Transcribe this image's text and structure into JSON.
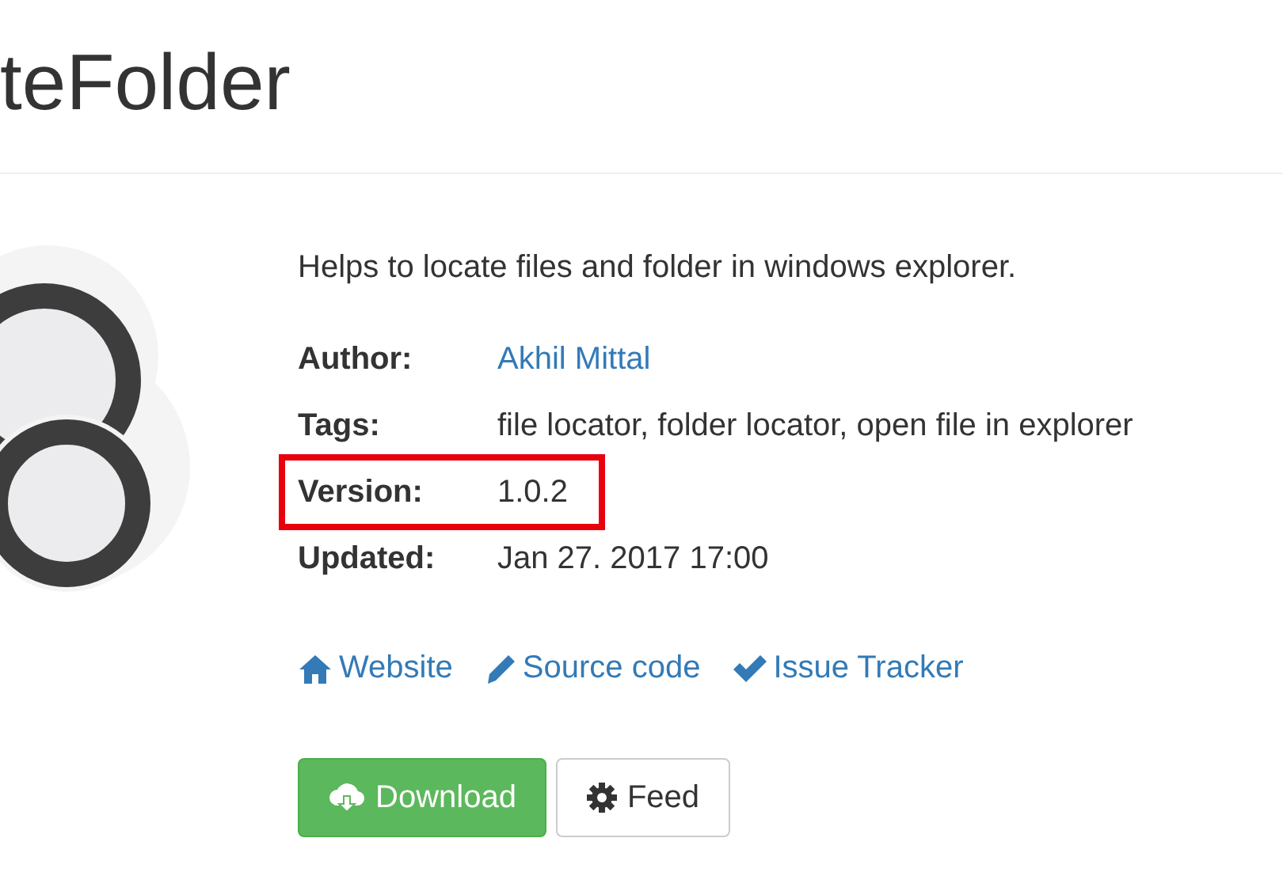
{
  "title": "teFolder",
  "description": "Helps to locate files and folder in windows explorer.",
  "details": [
    {
      "label": "Author:",
      "value": "Akhil Mittal",
      "kind": "link",
      "highlighted": false
    },
    {
      "label": "Tags:",
      "value": "file locator, folder locator, open file in explorer",
      "kind": "text",
      "highlighted": false
    },
    {
      "label": "Version:",
      "value": "1.0.2",
      "kind": "text",
      "highlighted": true
    },
    {
      "label": "Updated:",
      "value": "Jan 27. 2017 17:00",
      "kind": "text",
      "highlighted": false
    }
  ],
  "links": [
    {
      "label": "Website",
      "kind": "home"
    },
    {
      "label": "Source code",
      "kind": "pencil"
    },
    {
      "label": "Issue Tracker",
      "kind": "check"
    }
  ],
  "buttons": [
    {
      "label": "Download",
      "kind": "primary"
    },
    {
      "label": "Feed",
      "kind": "default"
    }
  ]
}
